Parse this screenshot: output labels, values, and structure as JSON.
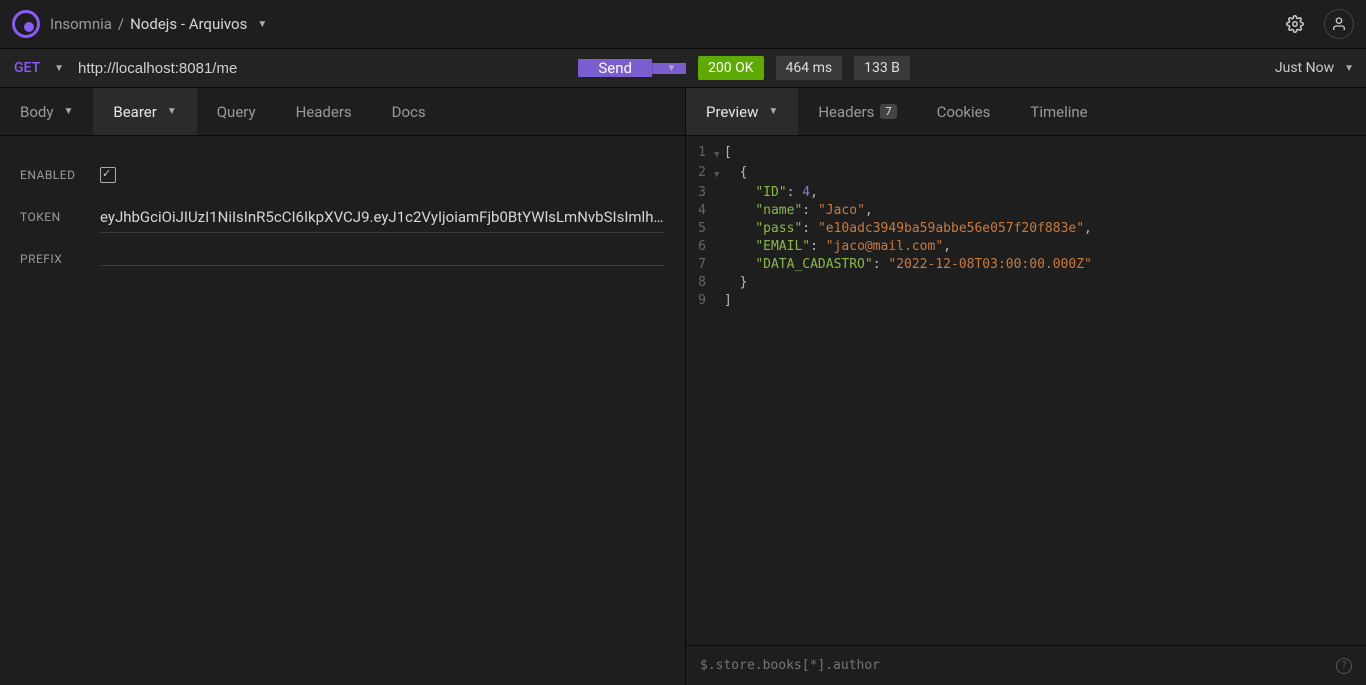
{
  "breadcrumb": {
    "root": "Insomnia",
    "sep": "/",
    "project": "Nodejs - Arquivos"
  },
  "request": {
    "method": "GET",
    "url": "http://localhost:8081/me",
    "send_label": "Send"
  },
  "response": {
    "status_code": "200",
    "status_text": "OK",
    "time": "464 ms",
    "size": "133 B",
    "when": "Just Now"
  },
  "left_tabs": {
    "body": "Body",
    "auth": "Bearer",
    "query": "Query",
    "headers": "Headers",
    "docs": "Docs"
  },
  "right_tabs": {
    "preview": "Preview",
    "headers": "Headers",
    "headers_badge": "7",
    "cookies": "Cookies",
    "timeline": "Timeline"
  },
  "auth_form": {
    "enabled_label": "ENABLED",
    "token_label": "TOKEN",
    "token_value": "eyJhbGciOiJIUzI1NiIsInR5cCI6IkpXVCJ9.eyJ1c2VyIjoiamFjb0BtYWlsLmNvbSIsImlhdC",
    "prefix_label": "PREFIX",
    "prefix_value": ""
  },
  "json_body": {
    "l1": "[",
    "l2": "  {",
    "l3": {
      "indent": "    ",
      "key": "\"ID\"",
      "colon": ": ",
      "val": "4",
      "trail": ","
    },
    "l4": {
      "indent": "    ",
      "key": "\"name\"",
      "colon": ": ",
      "val": "\"Jaco\"",
      "trail": ","
    },
    "l5": {
      "indent": "    ",
      "key": "\"pass\"",
      "colon": ": ",
      "val": "\"e10adc3949ba59abbe56e057f20f883e\"",
      "trail": ","
    },
    "l6": {
      "indent": "    ",
      "key": "\"EMAIL\"",
      "colon": ": ",
      "val": "\"jaco@mail.com\"",
      "trail": ","
    },
    "l7": {
      "indent": "    ",
      "key": "\"DATA_CADASTRO\"",
      "colon": ": ",
      "val": "\"2022-12-08T03:00:00.000Z\"",
      "trail": ""
    },
    "l8": "  }",
    "l9": "]"
  },
  "filter_placeholder": "$.store.books[*].author"
}
